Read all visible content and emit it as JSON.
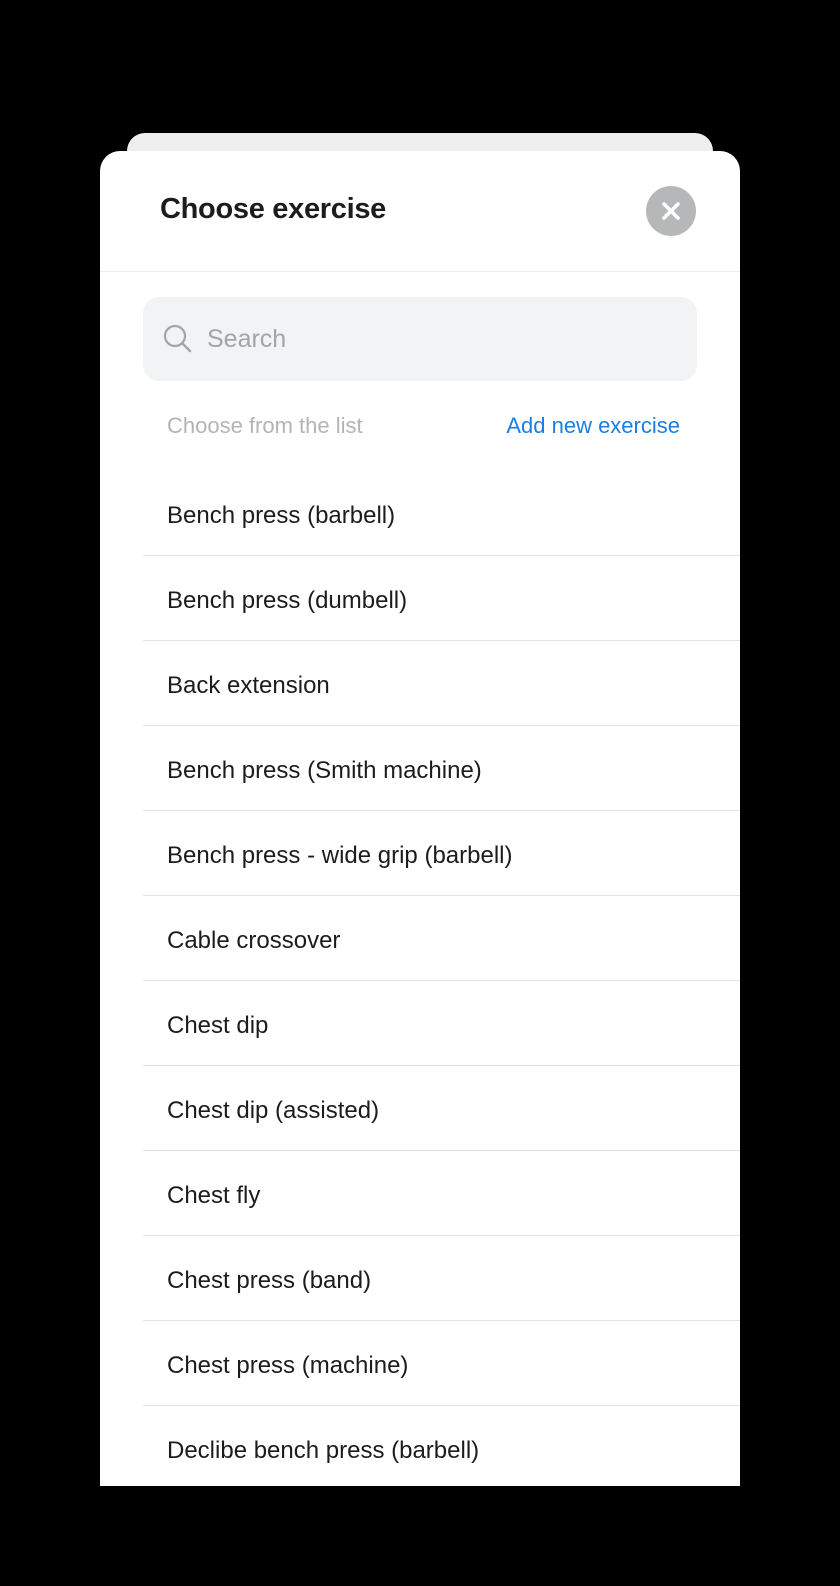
{
  "header": {
    "title": "Choose exercise",
    "close_icon": "close-icon"
  },
  "search": {
    "placeholder": "Search",
    "value": "",
    "icon": "search-icon"
  },
  "list_header": {
    "caption": "Choose from the list",
    "add_link": "Add new exercise"
  },
  "colors": {
    "accent": "#1a7fe0",
    "close_button": "#b6b7b9",
    "search_background": "#f2f3f5"
  },
  "exercises": [
    "Bench press (barbell)",
    "Bench press (dumbell)",
    "Back extension",
    "Bench press (Smith machine)",
    "Bench press - wide grip (barbell)",
    "Cable crossover",
    "Chest dip",
    "Chest dip (assisted)",
    "Chest fly",
    "Chest press (band)",
    "Chest press (machine)",
    "Declibe bench press (barbell)"
  ]
}
